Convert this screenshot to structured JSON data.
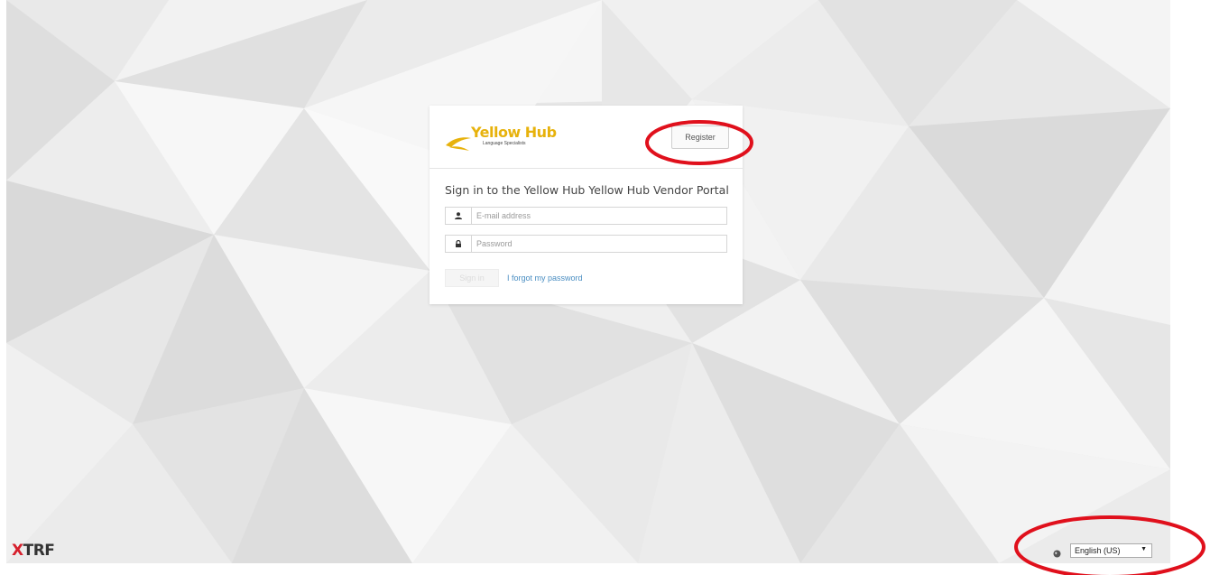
{
  "header": {
    "logo_text": "Yellow Hub",
    "logo_tagline": "Language Specialists",
    "register_label": "Register"
  },
  "form": {
    "title": "Sign in to the Yellow Hub Yellow Hub Vendor Portal",
    "email_placeholder": "E-mail address",
    "password_placeholder": "Password",
    "signin_label": "Sign in",
    "forgot_label": "I forgot my password"
  },
  "footer": {
    "brand_mark": "X",
    "brand_text": "TRF",
    "language_selected": "English (US)"
  },
  "icons": {
    "email": "user-icon",
    "password": "lock-icon",
    "language": "globe-icon",
    "dropdown": "caret-down-icon"
  },
  "colors": {
    "logo": "#e7b20c",
    "link": "#4a8ec2",
    "brand_mark": "#d61f2c",
    "annotation": "#e0101c"
  }
}
